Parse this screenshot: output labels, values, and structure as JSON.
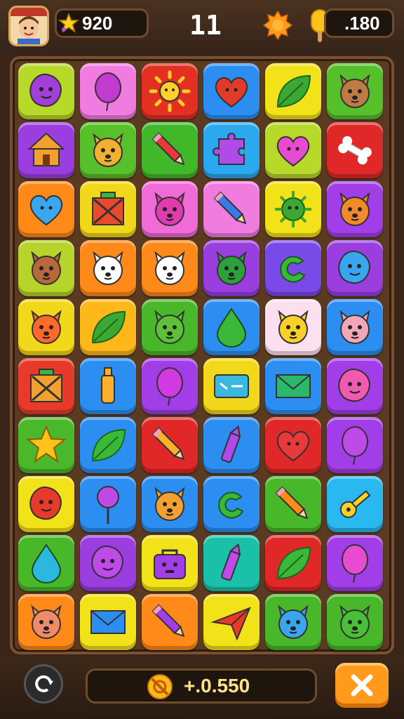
{
  "hud": {
    "score": "920",
    "level": "11",
    "coins": ".180",
    "score_icon": "star-icon",
    "booster_icon": "sun-badge-icon",
    "coins_icon": "popsicle-coin-icon"
  },
  "bottom": {
    "bonus": "+.0.550",
    "refresh_icon": "refresh-icon",
    "close_icon": "close-icon"
  },
  "board": {
    "rows": 10,
    "cols": 6,
    "tiles": [
      [
        {
          "c": "#b6d92a",
          "i": "blob",
          "g": "#a23fd8"
        },
        {
          "c": "#f07ce0",
          "i": "balloon",
          "g": "#c23ad0"
        },
        {
          "c": "#e43022",
          "i": "sun",
          "g": "#ffcf2a"
        },
        {
          "c": "#2b8ef0",
          "i": "heart",
          "g": "#e23a2a"
        },
        {
          "c": "#f2e21a",
          "i": "leaf",
          "g": "#3aa832"
        },
        {
          "c": "#56c02a",
          "i": "animal",
          "g": "#c07a44"
        }
      ],
      [
        {
          "c": "#9a3ee0",
          "i": "house",
          "g": "#f2a030"
        },
        {
          "c": "#58c02a",
          "i": "animal",
          "g": "#f0b030"
        },
        {
          "c": "#40b82a",
          "i": "pencil",
          "g": "#e83a3a"
        },
        {
          "c": "#2aa8f0",
          "i": "puzzle",
          "g": "#b04ae8"
        },
        {
          "c": "#b8d82a",
          "i": "heart",
          "g": "#e84ad0"
        },
        {
          "c": "#e02828",
          "i": "bone",
          "g": "#ffffff"
        }
      ],
      [
        {
          "c": "#ff8a1a",
          "i": "heart",
          "g": "#3aa6f0"
        },
        {
          "c": "#f2d81a",
          "i": "box",
          "g": "#e84a2a"
        },
        {
          "c": "#f06ad8",
          "i": "animal",
          "g": "#e03cb0"
        },
        {
          "c": "#f07ce0",
          "i": "pencil",
          "g": "#3a7ae8"
        },
        {
          "c": "#f2e21a",
          "i": "virus",
          "g": "#3aa832"
        },
        {
          "c": "#a23ee8",
          "i": "animal",
          "g": "#f08a2a"
        }
      ],
      [
        {
          "c": "#b6d42a",
          "i": "animal",
          "g": "#b8683a"
        },
        {
          "c": "#ff8a1a",
          "i": "animal",
          "g": "#ffffff"
        },
        {
          "c": "#ff8a1a",
          "i": "animal",
          "g": "#ffffff"
        },
        {
          "c": "#9a3ee0",
          "i": "animal",
          "g": "#2ea03a"
        },
        {
          "c": "#7a4ae8",
          "i": "swirl",
          "g": "#3ab83a"
        },
        {
          "c": "#9a3ee0",
          "i": "blob",
          "g": "#3aa6f0"
        }
      ],
      [
        {
          "c": "#f2d81a",
          "i": "animal",
          "g": "#ff6a2a"
        },
        {
          "c": "#ffb81a",
          "i": "leaf",
          "g": "#3aa832"
        },
        {
          "c": "#48b82a",
          "i": "animal",
          "g": "#5cc03a"
        },
        {
          "c": "#2b8ef0",
          "i": "drop",
          "g": "#3ab83a"
        },
        {
          "c": "#fde0f0",
          "i": "animal",
          "g": "#f8d22a"
        },
        {
          "c": "#2b8ef0",
          "i": "animal",
          "g": "#f0a8b8"
        }
      ],
      [
        {
          "c": "#e83a2a",
          "i": "box",
          "g": "#f2a030"
        },
        {
          "c": "#2b8ef0",
          "i": "bottle",
          "g": "#ffb02a"
        },
        {
          "c": "#a23ee8",
          "i": "balloon",
          "g": "#d03ae0"
        },
        {
          "c": "#f2d81a",
          "i": "card",
          "g": "#3ab8e0"
        },
        {
          "c": "#2b8ef0",
          "i": "envelope",
          "g": "#2ab86a"
        },
        {
          "c": "#a23ee8",
          "i": "blob",
          "g": "#f05ab0"
        }
      ],
      [
        {
          "c": "#4ab82a",
          "i": "star",
          "g": "#ffc21a"
        },
        {
          "c": "#2b8ef0",
          "i": "leaf",
          "g": "#3ab83a"
        },
        {
          "c": "#e02828",
          "i": "pencil",
          "g": "#ffb02a"
        },
        {
          "c": "#2b8ef0",
          "i": "crayon",
          "g": "#b04ae8"
        },
        {
          "c": "#e02828",
          "i": "heart",
          "g": "#e83a3a"
        },
        {
          "c": "#a23ee8",
          "i": "balloon",
          "g": "#c04ae8"
        }
      ],
      [
        {
          "c": "#f2e21a",
          "i": "blob",
          "g": "#e83a2a"
        },
        {
          "c": "#2b8ef0",
          "i": "lollipop",
          "g": "#c04ae8"
        },
        {
          "c": "#2b8ef0",
          "i": "animal",
          "g": "#f2a030"
        },
        {
          "c": "#2b8ef0",
          "i": "swirl",
          "g": "#3ab83a"
        },
        {
          "c": "#48b82a",
          "i": "pencil",
          "g": "#ff8a1a"
        },
        {
          "c": "#2ab8f0",
          "i": "key",
          "g": "#f8d22a"
        }
      ],
      [
        {
          "c": "#48b82a",
          "i": "drop",
          "g": "#2ab8e0"
        },
        {
          "c": "#9a3ee0",
          "i": "blob",
          "g": "#c04ae8"
        },
        {
          "c": "#f2e21a",
          "i": "bag",
          "g": "#a23ee8"
        },
        {
          "c": "#1ac0a8",
          "i": "crayon",
          "g": "#c04ae8"
        },
        {
          "c": "#e02828",
          "i": "leaf",
          "g": "#3ab83a"
        },
        {
          "c": "#a23ee8",
          "i": "balloon",
          "g": "#e84ad0"
        }
      ],
      [
        {
          "c": "#ff8a1a",
          "i": "animal",
          "g": "#f08a6a"
        },
        {
          "c": "#f2e21a",
          "i": "envelope",
          "g": "#2b8ef0"
        },
        {
          "c": "#ff8a1a",
          "i": "pencil",
          "g": "#a23ee8"
        },
        {
          "c": "#f2e21a",
          "i": "plane",
          "g": "#e83a2a"
        },
        {
          "c": "#48b82a",
          "i": "animal",
          "g": "#3aa6f0"
        },
        {
          "c": "#48b82a",
          "i": "animal",
          "g": "#4ac03a"
        }
      ]
    ]
  }
}
